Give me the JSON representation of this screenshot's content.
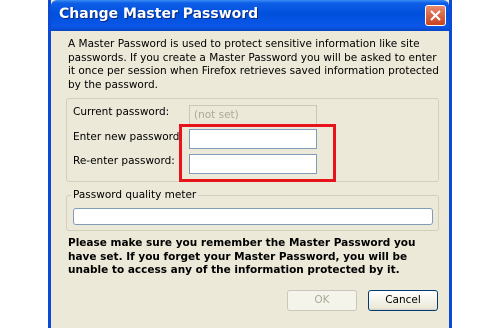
{
  "window": {
    "title": "Change Master Password"
  },
  "description": "A Master Password is used to protect sensitive information like site passwords. If you create a Master Password you will be asked to enter it once per session when Firefox retrieves saved information protected by the password.",
  "form": {
    "current_label": "Current password:",
    "current_value": "(not set)",
    "new_label": "Enter new password:",
    "new_value": "",
    "reenter_label": "Re-enter password:",
    "reenter_value": ""
  },
  "quality_meter": {
    "label": "Password quality meter",
    "level": 0
  },
  "warning": "Please make sure you remember the Master Password you have set. If you forget your Master Password, you will be unable to access any of the information protected by it.",
  "buttons": {
    "ok": "OK",
    "cancel": "Cancel"
  },
  "colors": {
    "title_bar": "#0050dc",
    "highlight_box": "#e8141c",
    "dialog_face": "#ece9d8"
  }
}
